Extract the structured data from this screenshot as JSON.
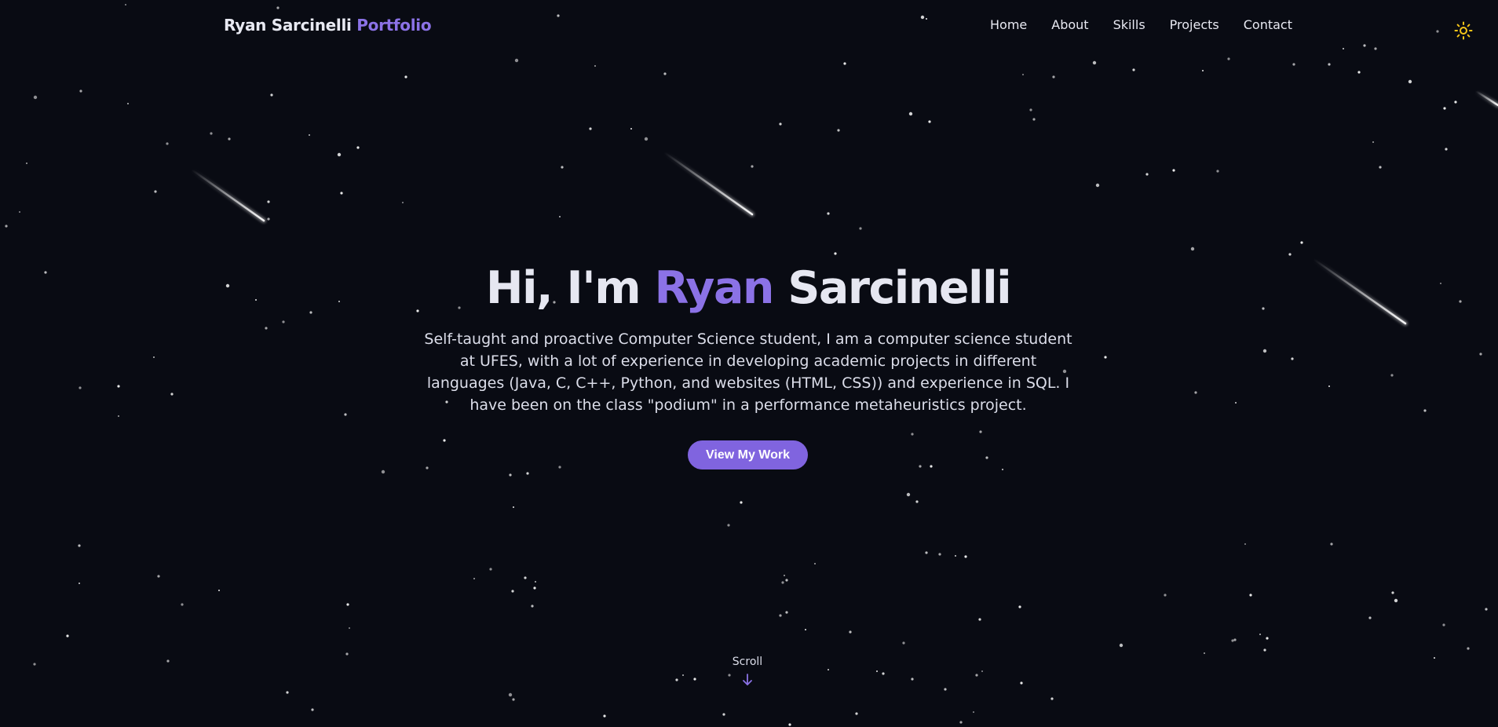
{
  "nav": {
    "brand_name": "Ryan Sarcinelli",
    "brand_suffix": "Portfolio",
    "links": [
      "Home",
      "About",
      "Skills",
      "Projects",
      "Contact"
    ],
    "theme_toggle_icon": "sun-icon"
  },
  "hero": {
    "greeting": "Hi, I'm",
    "first_name": "Ryan",
    "last_name": "Sarcinelli",
    "description": "Self-taught and proactive Computer Science student, I am a computer science student at UFES, with a lot of experience in developing academic projects in different languages (Java, C, C++, Python, and websites (HTML, CSS)) and experience in SQL. I have been on the class \"podium\" in a performance metaheuristics project.",
    "cta_label": "View My Work",
    "scroll_label": "Scroll",
    "scroll_icon": "arrow-down-icon"
  },
  "colors": {
    "background": "#090b13",
    "accent": "#8b72e6",
    "button": "#8064df",
    "sun_icon": "#f5c518",
    "text": "#e6e7f1"
  }
}
